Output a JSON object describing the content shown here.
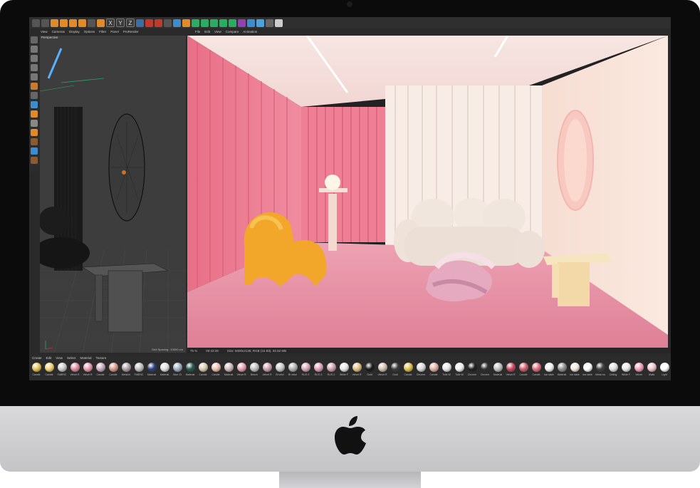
{
  "app": {
    "main_menu": [
      "View",
      "Cameras",
      "Display",
      "Options",
      "Filter",
      "Panel",
      "ProRender"
    ],
    "picture_viewer_menu": [
      "File",
      "Edit",
      "View",
      "Compare",
      "Animation"
    ],
    "material_menu": [
      "Create",
      "Edit",
      "View",
      "Select",
      "Material",
      "Texture"
    ],
    "axis_buttons": [
      "X",
      "Y",
      "Z"
    ]
  },
  "viewport": {
    "label": "Perspective",
    "grid_spacing": "Grid Spacing : 10000 cm"
  },
  "render": {
    "zoom": "75 %",
    "time": "00:43:28",
    "size_info": "Size: 5000x3138, RGB (16 Bit), 92.82 MB"
  },
  "materials": [
    {
      "name": "Candle",
      "color": "#e8c35a"
    },
    {
      "name": "Candle",
      "color": "#f0d070"
    },
    {
      "name": "FABRIC",
      "color": "#c9c9c9"
    },
    {
      "name": "Velvet R",
      "color": "#e08ca0"
    },
    {
      "name": "Velvet R",
      "color": "#e79aae"
    },
    {
      "name": "Candle",
      "color": "#c8a8c0"
    },
    {
      "name": "Candle",
      "color": "#d79a8a"
    },
    {
      "name": "Metal bl",
      "color": "#b0a0a8"
    },
    {
      "name": "FABRIC",
      "color": "#bfbfbf"
    },
    {
      "name": "Material",
      "color": "#2d3f7a"
    },
    {
      "name": "Material",
      "color": "#e0e0e0"
    },
    {
      "name": "Blue Gl",
      "color": "#a0b0c0"
    },
    {
      "name": "Material",
      "color": "#26594c"
    },
    {
      "name": "Candle",
      "color": "#d8cdb0"
    },
    {
      "name": "Candle",
      "color": "#f0c0b0"
    },
    {
      "name": "Material",
      "color": "#d0b8b8"
    },
    {
      "name": "Velvet R",
      "color": "#e6a0b0"
    },
    {
      "name": "Bench",
      "color": "#c0c0c0"
    },
    {
      "name": "Velvet R",
      "color": "#d0a0b0"
    },
    {
      "name": "Bl velvt",
      "color": "#c8c8c8"
    },
    {
      "name": "Bl velve",
      "color": "#b0b0b0"
    },
    {
      "name": "RUG 3",
      "color": "#d8a8b8"
    },
    {
      "name": "RUG 3",
      "color": "#e0a0b8"
    },
    {
      "name": "RUG 2",
      "color": "#cfa0b0"
    },
    {
      "name": "White F",
      "color": "#e8e8e8"
    },
    {
      "name": "Velvet R",
      "color": "#e0c080"
    },
    {
      "name": "Gold",
      "color": "#1a1a1a"
    },
    {
      "name": "Velvet R",
      "color": "#d0c0b0"
    },
    {
      "name": "Gold",
      "color": "#3a3a3a"
    },
    {
      "name": "Candle",
      "color": "#e0c050"
    },
    {
      "name": "Chrome",
      "color": "#d8d8d8"
    },
    {
      "name": "Candle",
      "color": "#e0b0a0"
    },
    {
      "name": "Tulle W",
      "color": "#e6e6e6"
    },
    {
      "name": "Tulle W",
      "color": "#f0f0f0"
    },
    {
      "name": "Chrome",
      "color": "#202020"
    },
    {
      "name": "Chrome",
      "color": "#303030"
    },
    {
      "name": "Material",
      "color": "#c0c0c0"
    },
    {
      "name": "Velvet R",
      "color": "#c84860"
    },
    {
      "name": "Candle",
      "color": "#d06070"
    },
    {
      "name": "Candle",
      "color": "#e07080"
    },
    {
      "name": "bar table",
      "color": "#f0f0f0"
    },
    {
      "name": "Material",
      "color": "#909090"
    },
    {
      "name": "bar table",
      "color": "#f4e8e0"
    },
    {
      "name": "bar table",
      "color": "#ffffff"
    },
    {
      "name": "Metal ba",
      "color": "#404040"
    },
    {
      "name": "Ceiling",
      "color": "#e0e0e0"
    },
    {
      "name": "White F",
      "color": "#e8e8e8"
    },
    {
      "name": "Velvet",
      "color": "#f0a0b8"
    },
    {
      "name": "Walls",
      "color": "#f0c0c8"
    },
    {
      "name": "Light",
      "color": "#ffffff"
    }
  ]
}
